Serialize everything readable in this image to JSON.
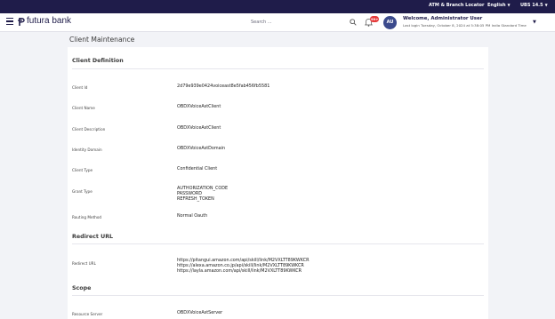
{
  "topbar": {
    "atm_locator": "ATM & Branch Locator",
    "language": "English",
    "version": "UBS 14.5"
  },
  "header": {
    "logo_text": "futura bank",
    "search_placeholder": "Search ...",
    "notification_count": "99+",
    "avatar_initials": "AU",
    "welcome": "Welcome, Administrator User",
    "last_login": "Last login Tuesday, October 8, 2024 at 5:38:05 PM India Standard Time"
  },
  "page": {
    "title": "Client Maintenance"
  },
  "sections": {
    "client_definition": {
      "title": "Client Definition",
      "fields": [
        {
          "label": "Client Id",
          "value": "2d79e939e0424voiceast8e5fab456fb5581"
        },
        {
          "label": "Client Name",
          "value": "OBDXVoiceAstClient"
        },
        {
          "label": "Client Description",
          "value": "OBDXVoiceAstClient"
        },
        {
          "label": "Identity Domain",
          "value": "OBDXVoiceAstDomain"
        },
        {
          "label": "Client Type",
          "value": "Confidential Client"
        },
        {
          "label": "Grant Type",
          "lines": [
            "AUTHORIZATION_CODE",
            "PASSWORD",
            "REFRESH_TOKEN"
          ]
        },
        {
          "label": "Routing Method",
          "value": "Normal Oauth"
        }
      ]
    },
    "redirect_url": {
      "title": "Redirect URL",
      "label": "Redirect URL",
      "lines": [
        "https://pitangui.amazon.com/api/skill/link/M2VXLTT89KWKCR",
        "https://alexa.amazon.co.jp/api/skill/link/M2VXLTT89KWKCR",
        "https://layla.amazon.com/api/skill/link/M2VXLTT89KWKCR"
      ]
    },
    "scope": {
      "title": "Scope",
      "label": "Resource Server",
      "value": "OBDXVoiceAstServer"
    }
  }
}
